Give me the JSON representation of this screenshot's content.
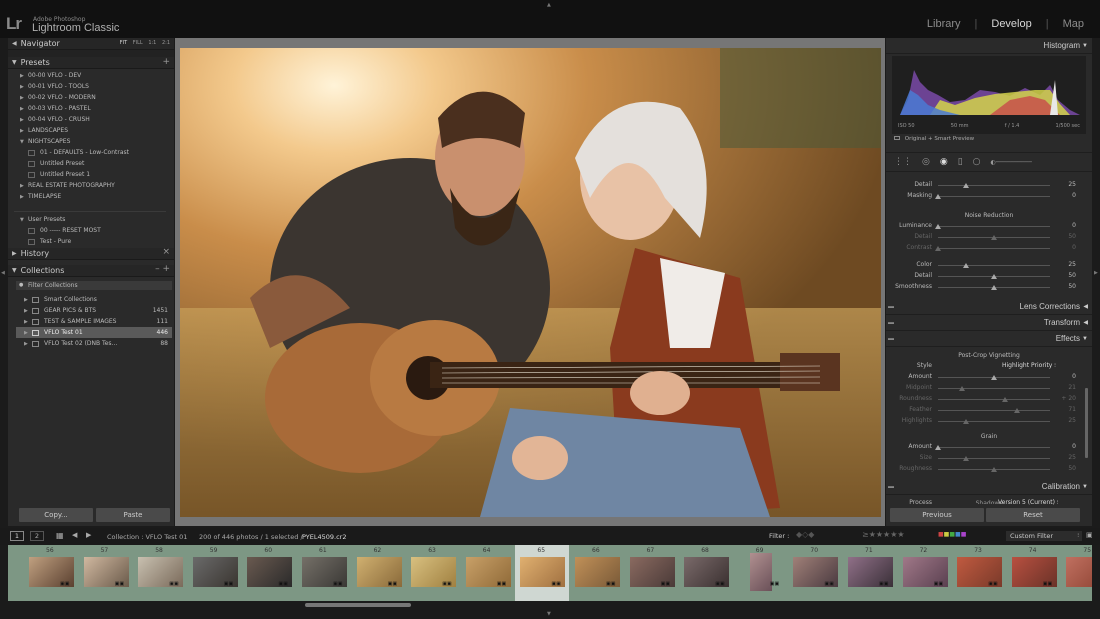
{
  "app": {
    "subtitle": "Adobe Photoshop",
    "name": "Lightroom Classic",
    "logo": "Lr",
    "modules": [
      "Library",
      "Develop",
      "Map"
    ],
    "active_module": "Develop"
  },
  "navigator": {
    "title": "Navigator",
    "zoom_options": [
      "FIT",
      "FILL",
      "1:1",
      "2:1"
    ]
  },
  "presets": {
    "title": "Presets",
    "add_icon": "+",
    "items": [
      {
        "label": "00-00 VFLO - DEV",
        "type": "folder"
      },
      {
        "label": "00-01 VFLO - TOOLS",
        "type": "folder"
      },
      {
        "label": "00-02 VFLO - MODERN",
        "type": "folder"
      },
      {
        "label": "00-03 VFLO - PASTEL",
        "type": "folder"
      },
      {
        "label": "00-04 VFLO - CRUSH",
        "type": "folder"
      },
      {
        "label": "LANDSCAPES",
        "type": "folder"
      },
      {
        "label": "NIGHTSCAPES",
        "type": "folder-open"
      },
      {
        "label": "01 - DEFAULTS - Low-Contrast",
        "type": "preset"
      },
      {
        "label": "Untitled Preset",
        "type": "preset"
      },
      {
        "label": "Untitled Preset 1",
        "type": "preset"
      },
      {
        "label": "REAL ESTATE PHOTOGRAPHY",
        "type": "folder"
      },
      {
        "label": "TIMELAPSE",
        "type": "folder"
      }
    ],
    "user_presets": {
      "label": "User Presets",
      "items": [
        "00 ----- RESET MOST",
        "Test - Pure"
      ]
    }
  },
  "history": {
    "title": "History",
    "close_icon": "×"
  },
  "collections": {
    "title": "Collections",
    "filter_label": "Filter Collections",
    "items": [
      {
        "label": "Smart Collections",
        "count": ""
      },
      {
        "label": "GEAR PICS & BTS",
        "count": "1451"
      },
      {
        "label": "TEST & SAMPLE IMAGES",
        "count": "111"
      },
      {
        "label": "VFLO Test 01",
        "count": "446"
      },
      {
        "label": "VFLO Test 02 (DNB Tes...",
        "count": "88"
      }
    ]
  },
  "left_buttons": {
    "copy": "Copy...",
    "paste": "Paste"
  },
  "histogram": {
    "title": "Histogram",
    "iso": "ISO 50",
    "focal": "50 mm",
    "aperture": "f / 1.4",
    "shutter": "1/500 sec",
    "preview_label": "Original + Smart Preview"
  },
  "detail": {
    "sliders": [
      {
        "label": "Detail",
        "value": "25",
        "pos": 0.25
      },
      {
        "label": "Masking",
        "value": "0",
        "pos": 0.0
      }
    ],
    "noise_title": "Noise Reduction",
    "noise_sliders": [
      {
        "label": "Luminance",
        "value": "0",
        "pos": 0.0,
        "dim": false
      },
      {
        "label": "Detail",
        "value": "50",
        "pos": 0.5,
        "dim": true
      },
      {
        "label": "Contrast",
        "value": "0",
        "pos": 0.0,
        "dim": true
      },
      {
        "label": "Color",
        "value": "25",
        "pos": 0.25,
        "dim": false
      },
      {
        "label": "Detail",
        "value": "50",
        "pos": 0.5,
        "dim": false
      },
      {
        "label": "Smoothness",
        "value": "50",
        "pos": 0.5,
        "dim": false
      }
    ]
  },
  "sections": {
    "lens": "Lens Corrections",
    "transform": "Transform",
    "effects": "Effects",
    "calibration": "Calibration"
  },
  "effects": {
    "vignette_title": "Post-Crop Vignetting",
    "style_label": "Style",
    "style_value": "Highlight Priority",
    "vignette_sliders": [
      {
        "label": "Amount",
        "value": "0",
        "pos": 0.5,
        "dim": false
      },
      {
        "label": "Midpoint",
        "value": "21",
        "pos": 0.21,
        "dim": true
      },
      {
        "label": "Roundness",
        "value": "+ 20",
        "pos": 0.6,
        "dim": true
      },
      {
        "label": "Feather",
        "value": "71",
        "pos": 0.71,
        "dim": true
      },
      {
        "label": "Highlights",
        "value": "25",
        "pos": 0.25,
        "dim": true
      }
    ],
    "grain_title": "Grain",
    "grain_sliders": [
      {
        "label": "Amount",
        "value": "0",
        "pos": 0.0,
        "dim": false
      },
      {
        "label": "Size",
        "value": "25",
        "pos": 0.25,
        "dim": true
      },
      {
        "label": "Roughness",
        "value": "50",
        "pos": 0.5,
        "dim": true
      }
    ]
  },
  "calibration": {
    "process_label": "Process",
    "process_value": "Version 5 (Current)",
    "shadows_label": "Shadows"
  },
  "right_buttons": {
    "previous": "Previous",
    "reset": "Reset"
  },
  "filmstrip_bar": {
    "pages": [
      "1",
      "2"
    ],
    "collection": "Collection : VFLO Test 01",
    "count": "200 of 446 photos / 1 selected /",
    "filename": "PYEL4509.cr2",
    "filter_label": "Filter :",
    "custom_filter": "Custom Filter"
  },
  "filmstrip": {
    "numbers": [
      "56",
      "57",
      "58",
      "59",
      "60",
      "61",
      "62",
      "63",
      "64",
      "65",
      "66",
      "67",
      "68",
      "69",
      "70",
      "71",
      "72",
      "73",
      "74",
      "75"
    ],
    "selected": "65"
  },
  "colors": {
    "filmstrip_bg": "#7d9784",
    "panel_bg": "#2a2a2a",
    "accent_text": "#d8d8d8"
  }
}
